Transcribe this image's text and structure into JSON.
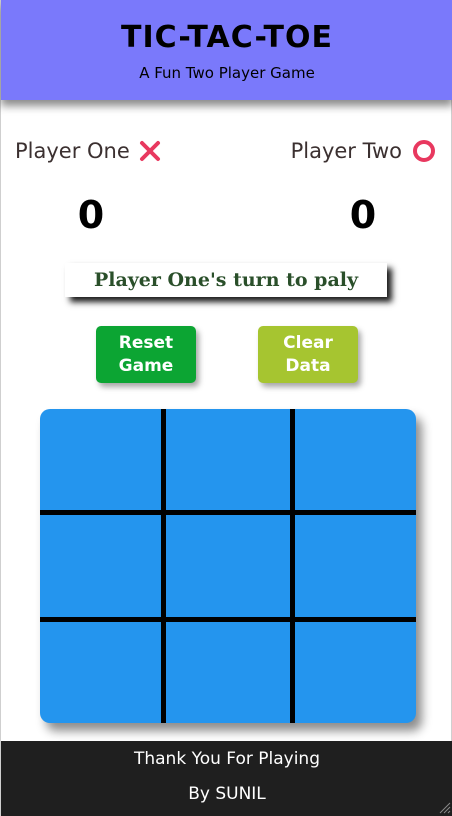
{
  "header": {
    "title": "TIC-TAC-TOE",
    "subtitle": "A Fun Two Player Game"
  },
  "players": [
    {
      "name": "Player One",
      "symbol": "x-icon",
      "score": "0"
    },
    {
      "name": "Player Two",
      "symbol": "o-icon",
      "score": "0"
    }
  ],
  "status": {
    "turn_text": "Player One's turn to paly"
  },
  "buttons": {
    "reset_label": "Reset\nGame",
    "clear_label": "Clear\nData"
  },
  "board": {
    "cells": [
      "",
      "",
      "",
      "",
      "",
      "",
      "",
      "",
      ""
    ]
  },
  "footer": {
    "line1": "Thank You For Playing",
    "line2": "By SUNIL"
  },
  "colors": {
    "header_bg": "#7a79fb",
    "board_bg": "#2495ee",
    "reset_button": "#0ca533",
    "clear_button": "#a6c530",
    "player_symbol": "#e8385f",
    "footer_bg": "#1f1f1f"
  }
}
